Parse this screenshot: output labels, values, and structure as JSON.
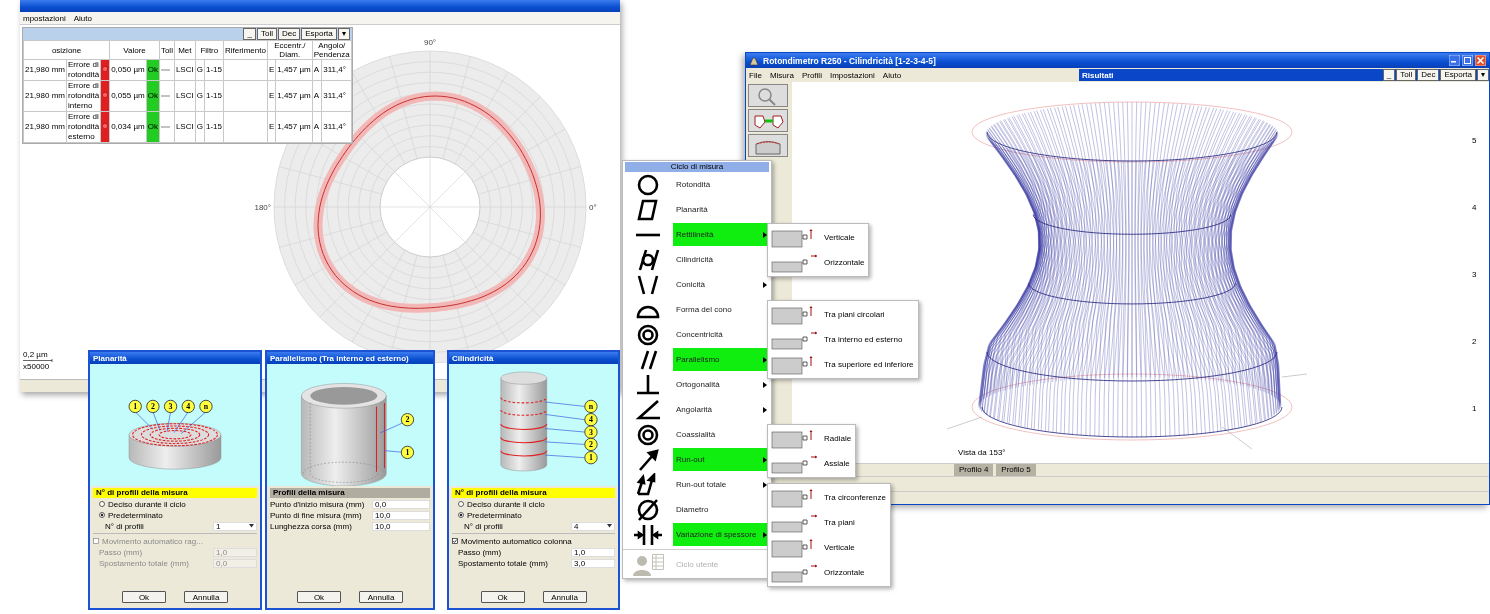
{
  "roundness_window": {
    "menu": [
      "mpostazioni",
      "Aiuto"
    ],
    "toolbar": [
      "_",
      "Toll",
      "Dec",
      "Esporta",
      "▾"
    ],
    "table": {
      "columns": [
        "osizione",
        "Valore",
        "Toll",
        "Met",
        "Filtro",
        "Riferimento",
        "Eccentr./ Diam.",
        "Angolo/ Pendenza"
      ],
      "rows": [
        {
          "position": "21,980 mm",
          "name": "Errore di rotondità",
          "value": "0,050 µm",
          "result": "Ok",
          "method": "LSCI",
          "filter_type": "G",
          "filter": "1-15",
          "reference": "",
          "ecc_flag": "E",
          "eccentricity": "1,457 µm",
          "ang_flag": "A",
          "angle": "311,4°"
        },
        {
          "position": "21,980 mm",
          "name": "Errore di rotondità interno",
          "value": "0,055 µm",
          "result": "Ok",
          "method": "LSCI",
          "filter_type": "G",
          "filter": "1-15",
          "reference": "",
          "ecc_flag": "E",
          "eccentricity": "1,457 µm",
          "ang_flag": "A",
          "angle": "311,4°"
        },
        {
          "position": "21,980 mm",
          "name": "Errore di rotondità esterno",
          "value": "0,034 µm",
          "result": "Ok",
          "method": "LSCI",
          "filter_type": "G",
          "filter": "1-15",
          "reference": "",
          "ecc_flag": "E",
          "eccentricity": "1,457 µm",
          "ang_flag": "A",
          "angle": "311,4°"
        }
      ]
    },
    "angle_labels": [
      "90°",
      "180°",
      "0°"
    ],
    "scale": "0,2 µm",
    "magnification": "x50000"
  },
  "dialogs": [
    {
      "title": "Planarità",
      "kind": "planar",
      "callouts": [
        "1",
        "2",
        "3",
        "4",
        "n"
      ],
      "section": "N° di profili della misura",
      "options": [
        {
          "label": "Deciso durante il ciclo",
          "selected": false
        },
        {
          "label": "Predeterminato",
          "selected": true
        }
      ],
      "count_label": "N° di profili",
      "count_value": "1",
      "auto_move": {
        "label": "Movimento automatico rag...",
        "checked": false,
        "disabled": true
      },
      "fields": [
        {
          "label": "Passo (mm)",
          "value": "1,0",
          "disabled": true
        },
        {
          "label": "Spostamento totale (mm)",
          "value": "0,0",
          "disabled": true
        }
      ],
      "buttons": [
        "Ok",
        "Annulla"
      ]
    },
    {
      "title": "Parallelismo (Tra interno ed esterno)",
      "kind": "parallel",
      "callouts": [
        "2",
        "1"
      ],
      "section": "Profili della misura",
      "fields": [
        {
          "label": "Punto d'inizio misura (mm)",
          "value": "0,0",
          "disabled": false
        },
        {
          "label": "Punto di fine misura (mm)",
          "value": "10,0",
          "disabled": false
        },
        {
          "label": "Lunghezza corsa (mm)",
          "value": "10,0",
          "disabled": false
        }
      ],
      "buttons": [
        "Ok",
        "Annulla"
      ]
    },
    {
      "title": "Cilindricità",
      "kind": "cylinder",
      "callouts": [
        "n",
        "4",
        "3",
        "2",
        "1"
      ],
      "section": "N° di profili della misura",
      "options": [
        {
          "label": "Deciso durante il ciclo",
          "selected": false
        },
        {
          "label": "Predeterminato",
          "selected": true
        }
      ],
      "count_label": "N° di profili",
      "count_value": "4",
      "auto_move": {
        "label": "Movimento automatico colonna",
        "checked": true,
        "disabled": false
      },
      "fields": [
        {
          "label": "Passo (mm)",
          "value": "1,0",
          "disabled": false
        },
        {
          "label": "Spostamento totale (mm)",
          "value": "3,0",
          "disabled": false
        }
      ],
      "buttons": [
        "Ok",
        "Annulla"
      ]
    }
  ],
  "menu": {
    "title": "Ciclo di misura",
    "items": [
      {
        "label": "Rotondità",
        "has_submenu": false,
        "selected": false,
        "disabled": false
      },
      {
        "label": "Planarità",
        "has_submenu": false,
        "selected": false,
        "disabled": false
      },
      {
        "label": "Rettilineità",
        "has_submenu": true,
        "selected": true,
        "disabled": false,
        "submenu": [
          "Verticale",
          "Orizzontale"
        ]
      },
      {
        "label": "Cilindricità",
        "has_submenu": false,
        "selected": false,
        "disabled": false
      },
      {
        "label": "Conicità",
        "has_submenu": true,
        "selected": false,
        "disabled": false
      },
      {
        "label": "Forma del cono",
        "has_submenu": false,
        "selected": false,
        "disabled": false
      },
      {
        "label": "Concentricità",
        "has_submenu": false,
        "selected": false,
        "disabled": false
      },
      {
        "label": "Parallelismo",
        "has_submenu": true,
        "selected": true,
        "disabled": false,
        "submenu": [
          "Tra piani circolari",
          "Tra interno ed esterno",
          "Tra superiore ed inferiore"
        ]
      },
      {
        "label": "Ortogonalità",
        "has_submenu": true,
        "selected": false,
        "disabled": false
      },
      {
        "label": "Angolarità",
        "has_submenu": true,
        "selected": false,
        "disabled": false
      },
      {
        "label": "Coassialità",
        "has_submenu": false,
        "selected": false,
        "disabled": false
      },
      {
        "label": "Run-out",
        "has_submenu": true,
        "selected": true,
        "disabled": false,
        "submenu": [
          "Radiale",
          "Assiale"
        ]
      },
      {
        "label": "Run-out totale",
        "has_submenu": true,
        "selected": false,
        "disabled": false
      },
      {
        "label": "Diametro",
        "has_submenu": false,
        "selected": false,
        "disabled": false
      },
      {
        "label": "Variazione di spessore",
        "has_submenu": true,
        "selected": true,
        "disabled": false,
        "submenu": [
          "Tra circonferenze",
          "Tra piani",
          "Verticale",
          "Orizzontale"
        ]
      },
      {
        "label": "Ciclo utente",
        "has_submenu": false,
        "selected": false,
        "disabled": true
      }
    ]
  },
  "cylindricity_window": {
    "title": "Rotondimetro R250 - Cilindricità [1-2-3-4-5]",
    "menu": [
      "File",
      "Misura",
      "Profili",
      "Impostazioni",
      "Aiuto"
    ],
    "results_title": "Risultati",
    "toolbar": [
      "_",
      "Toll",
      "Dec",
      "Esporta",
      "▾"
    ],
    "axis_labels": [
      "5",
      "4",
      "3",
      "2",
      "1"
    ],
    "view_label": "Vista da 153°",
    "tabs": [
      "Profilo 4",
      "Profilo 5"
    ]
  }
}
